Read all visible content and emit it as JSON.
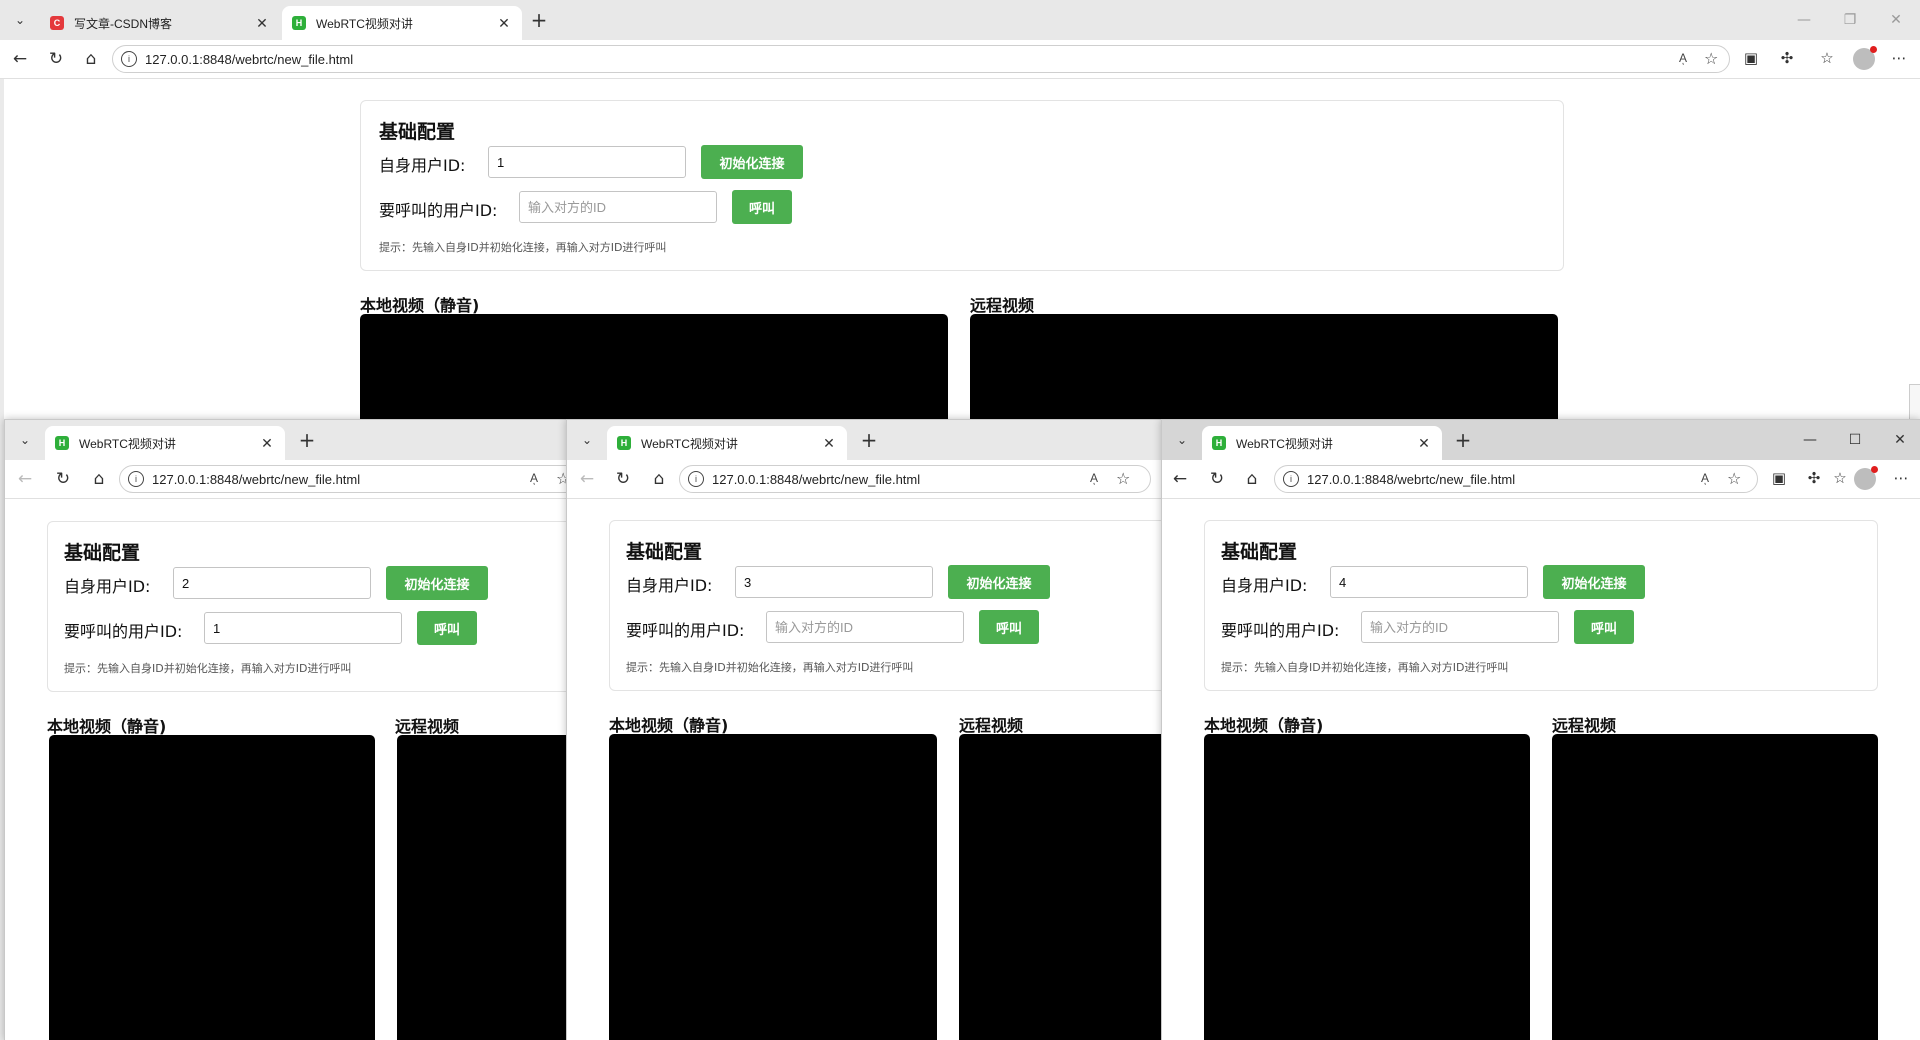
{
  "app": {
    "main_tabs": [
      {
        "title": "写文章-CSDN博客",
        "favicon": "C",
        "favicon_color": "#e4393c"
      },
      {
        "title": "WebRTC视频对讲",
        "favicon": "H",
        "favicon_color": "#2eaf3a"
      }
    ],
    "small_tab_title": "WebRTC视频对讲",
    "small_tab_favicon": "H",
    "url": "127.0.0.1:8848/webrtc/new_file.html",
    "read_aloud_label": "Aͅ",
    "icons": {
      "tab_list": "chevron-down-icon",
      "new_tab": "plus-icon",
      "back": "back-arrow-icon",
      "refresh": "refresh-icon",
      "home": "home-icon",
      "info": "info-icon",
      "favorite": "star-icon",
      "extensions": "puzzle-icon",
      "favorites_bar": "favorites-icon",
      "more": "more-icon"
    },
    "glyphs": {
      "tab_drop": "⌄",
      "close": "✕",
      "plus": "+",
      "back": "←",
      "refresh": "↻",
      "home": "⌂",
      "info": "i",
      "star": "☆",
      "wallet": "▣",
      "puzzle": "✣",
      "favorites": "☆",
      "more": "⋯",
      "minimize": "—",
      "maximize": "☐",
      "restore": "❐"
    }
  },
  "page": {
    "config_title": "基础配置",
    "self_id_label": "自身用户ID:",
    "call_id_label": "要呼叫的用户ID:",
    "call_id_placeholder": "输入对方的ID",
    "init_button": "初始化连接",
    "call_button": "呼叫",
    "hint": "提示：先输入自身ID并初始化连接，再输入对方ID进行呼叫",
    "local_video_label": "本地视频（静音)",
    "remote_video_label": "远程视频"
  },
  "windows": [
    {
      "self_id": "1",
      "call_id": ""
    },
    {
      "self_id": "2",
      "call_id": "1"
    },
    {
      "self_id": "3",
      "call_id": ""
    },
    {
      "self_id": "4",
      "call_id": ""
    }
  ],
  "colors": {
    "accent_green": "#4caf50",
    "video_bg": "#000000"
  }
}
